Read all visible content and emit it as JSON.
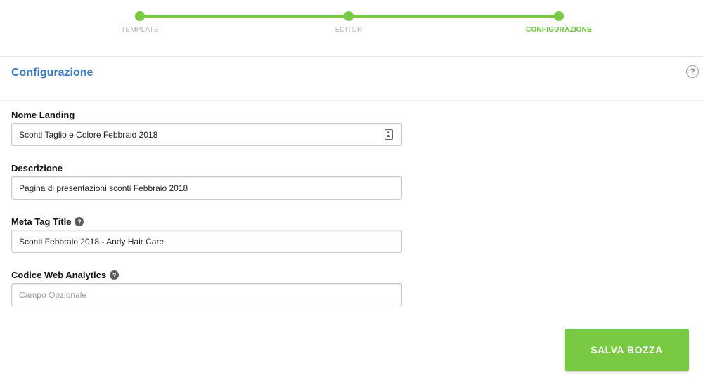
{
  "stepper": {
    "steps": [
      {
        "label": "TEMPLATE"
      },
      {
        "label": "EDITOR"
      },
      {
        "label": "CONFIGURAZIONE"
      }
    ],
    "active_step": "CONFIGURAZIONE",
    "accent_color": "#7ac943"
  },
  "section": {
    "title": "Configurazione",
    "help_glyph": "?"
  },
  "form": {
    "nome_landing": {
      "label": "Nome Landing",
      "value": "Sconti Taglio e Colore Febbraio 2018"
    },
    "descrizione": {
      "label": "Descrizione",
      "value": "Pagina di presentazioni sconti Febbraio 2018"
    },
    "meta_tag_title": {
      "label": "Meta Tag Title",
      "value": "Sconti Febbraio 2018 - Andy Hair Care"
    },
    "codice_web_analytics": {
      "label": "Codice Web Analytics",
      "value": "",
      "placeholder": "Campo Opzionale"
    },
    "help_glyph": "?"
  },
  "actions": {
    "save_draft_label": "SALVA BOZZA"
  },
  "colors": {
    "accent": "#7ac943",
    "title_blue": "#3b7cc4"
  }
}
